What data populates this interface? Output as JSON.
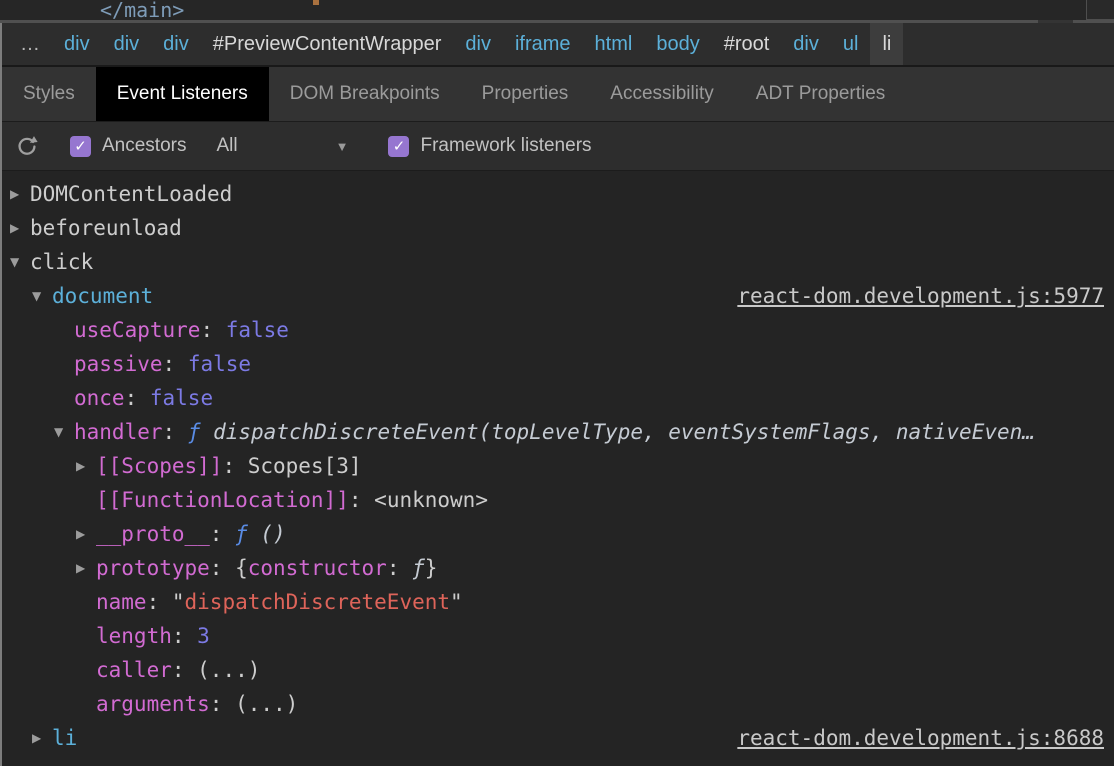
{
  "elements_strip": {
    "partial_code": "</main>"
  },
  "breadcrumb": {
    "items": [
      {
        "label": "…",
        "type": "more"
      },
      {
        "label": "div",
        "type": "tag"
      },
      {
        "label": "div",
        "type": "tag"
      },
      {
        "label": "div",
        "type": "tag"
      },
      {
        "label": "#PreviewContentWrapper",
        "type": "id"
      },
      {
        "label": "div",
        "type": "tag"
      },
      {
        "label": "iframe",
        "type": "tag"
      },
      {
        "label": "html",
        "type": "tag"
      },
      {
        "label": "body",
        "type": "tag"
      },
      {
        "label": "#root",
        "type": "id"
      },
      {
        "label": "div",
        "type": "tag"
      },
      {
        "label": "ul",
        "type": "tag"
      },
      {
        "label": "li",
        "type": "selected"
      }
    ]
  },
  "tabs": {
    "items": [
      {
        "label": "Styles",
        "active": false
      },
      {
        "label": "Event Listeners",
        "active": true
      },
      {
        "label": "DOM Breakpoints",
        "active": false
      },
      {
        "label": "Properties",
        "active": false
      },
      {
        "label": "Accessibility",
        "active": false
      },
      {
        "label": "ADT Properties",
        "active": false
      }
    ]
  },
  "toolbar": {
    "ancestors_label": "Ancestors",
    "ancestors_checked": true,
    "filter_value": "All",
    "framework_label": "Framework listeners",
    "framework_checked": true
  },
  "tree": {
    "rows": [
      {
        "indent": 0,
        "arrow": "collapsed",
        "segments": [
          [
            "plain",
            "DOMContentLoaded"
          ]
        ]
      },
      {
        "indent": 0,
        "arrow": "collapsed",
        "segments": [
          [
            "plain",
            "beforeunload"
          ]
        ]
      },
      {
        "indent": 0,
        "arrow": "expanded",
        "segments": [
          [
            "plain",
            "click"
          ]
        ]
      },
      {
        "indent": 1,
        "arrow": "expanded",
        "segments": [
          [
            "node",
            "document"
          ]
        ],
        "link": "react-dom.development.js:5977"
      },
      {
        "indent": 2,
        "arrow": "none",
        "segments": [
          [
            "prop",
            "useCapture"
          ],
          [
            "plain",
            ": "
          ],
          [
            "num",
            "false"
          ]
        ]
      },
      {
        "indent": 2,
        "arrow": "none",
        "segments": [
          [
            "prop",
            "passive"
          ],
          [
            "plain",
            ": "
          ],
          [
            "num",
            "false"
          ]
        ]
      },
      {
        "indent": 2,
        "arrow": "none",
        "segments": [
          [
            "prop",
            "once"
          ],
          [
            "plain",
            ": "
          ],
          [
            "num",
            "false"
          ]
        ]
      },
      {
        "indent": 2,
        "arrow": "expanded",
        "segments": [
          [
            "prop",
            "handler"
          ],
          [
            "plain",
            ": "
          ],
          [
            "fn",
            "ƒ "
          ],
          [
            "sig",
            "dispatchDiscreteEvent(topLevelType, eventSystemFlags, nativeEven…"
          ]
        ]
      },
      {
        "indent": 3,
        "arrow": "collapsed",
        "segments": [
          [
            "prop",
            "[[Scopes]]"
          ],
          [
            "plain",
            ": "
          ],
          [
            "plain",
            "Scopes[3]"
          ]
        ]
      },
      {
        "indent": 3,
        "arrow": "none",
        "segments": [
          [
            "prop",
            "[[FunctionLocation]]"
          ],
          [
            "plain",
            ": "
          ],
          [
            "plain",
            "<unknown>"
          ]
        ]
      },
      {
        "indent": 3,
        "arrow": "collapsed",
        "segments": [
          [
            "prop",
            "__proto__"
          ],
          [
            "plain",
            ": "
          ],
          [
            "fn",
            "ƒ "
          ],
          [
            "sig",
            "()"
          ]
        ]
      },
      {
        "indent": 3,
        "arrow": "collapsed",
        "segments": [
          [
            "prop",
            "prototype"
          ],
          [
            "plain",
            ": {"
          ],
          [
            "prop",
            "constructor"
          ],
          [
            "plain",
            ": "
          ],
          [
            "sig",
            "ƒ"
          ],
          [
            "plain",
            "}"
          ]
        ]
      },
      {
        "indent": 3,
        "arrow": "none",
        "segments": [
          [
            "prop",
            "name"
          ],
          [
            "plain",
            ": \""
          ],
          [
            "str",
            "dispatchDiscreteEvent"
          ],
          [
            "plain",
            "\""
          ]
        ]
      },
      {
        "indent": 3,
        "arrow": "none",
        "segments": [
          [
            "prop",
            "length"
          ],
          [
            "plain",
            ": "
          ],
          [
            "num",
            "3"
          ]
        ]
      },
      {
        "indent": 3,
        "arrow": "none",
        "segments": [
          [
            "prop",
            "caller"
          ],
          [
            "plain",
            ": "
          ],
          [
            "plain",
            "(...)"
          ]
        ]
      },
      {
        "indent": 3,
        "arrow": "none",
        "segments": [
          [
            "prop",
            "arguments"
          ],
          [
            "plain",
            ": "
          ],
          [
            "plain",
            "(...)"
          ]
        ]
      },
      {
        "indent": 1,
        "arrow": "collapsed",
        "segments": [
          [
            "node",
            "li"
          ]
        ],
        "link": "react-dom.development.js:8688"
      }
    ]
  },
  "colors": {
    "panel_bg": "#242424",
    "bar_bg": "#2d2d2d",
    "tabbar_bg": "#333333",
    "active_tab_bg": "#000000",
    "checkbox_accent": "#9676d0",
    "node_blue": "#5cb0d9",
    "property_pink": "#d26bd2",
    "value_violet": "#7c7ae4",
    "string_red": "#de645a",
    "function_blue": "#5a8ce5",
    "link_gray": "#c9c9c9"
  }
}
